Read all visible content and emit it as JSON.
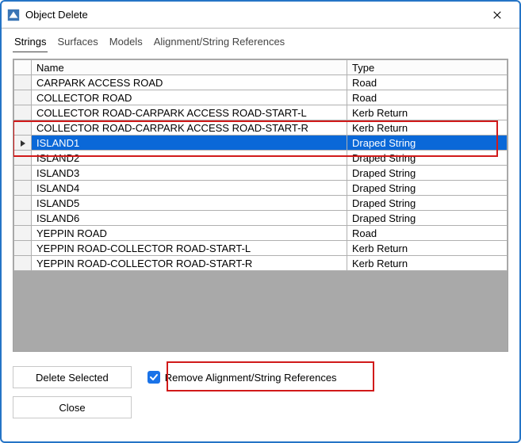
{
  "window": {
    "title": "Object Delete"
  },
  "tabs": {
    "items": [
      {
        "label": "Strings",
        "selected": true
      },
      {
        "label": "Surfaces",
        "selected": false
      },
      {
        "label": "Models",
        "selected": false
      },
      {
        "label": "Alignment/String References",
        "selected": false
      }
    ]
  },
  "grid": {
    "headers": {
      "name": "Name",
      "type": "Type"
    },
    "rows": [
      {
        "name": "CARPARK ACCESS ROAD",
        "type": "Road",
        "selected": false
      },
      {
        "name": "COLLECTOR ROAD",
        "type": "Road",
        "selected": false
      },
      {
        "name": "COLLECTOR ROAD-CARPARK ACCESS ROAD-START-L",
        "type": "Kerb Return",
        "selected": false
      },
      {
        "name": "COLLECTOR ROAD-CARPARK ACCESS ROAD-START-R",
        "type": "Kerb Return",
        "selected": false
      },
      {
        "name": "ISLAND1",
        "type": "Draped String",
        "selected": true
      },
      {
        "name": "ISLAND2",
        "type": "Draped String",
        "selected": false
      },
      {
        "name": "ISLAND3",
        "type": "Draped String",
        "selected": false
      },
      {
        "name": "ISLAND4",
        "type": "Draped String",
        "selected": false
      },
      {
        "name": "ISLAND5",
        "type": "Draped String",
        "selected": false
      },
      {
        "name": "ISLAND6",
        "type": "Draped String",
        "selected": false
      },
      {
        "name": "YEPPIN ROAD",
        "type": "Road",
        "selected": false
      },
      {
        "name": "YEPPIN ROAD-COLLECTOR ROAD-START-L",
        "type": "Kerb Return",
        "selected": false
      },
      {
        "name": "YEPPIN ROAD-COLLECTOR ROAD-START-R",
        "type": "Kerb Return",
        "selected": false
      }
    ]
  },
  "buttons": {
    "delete_selected": "Delete Selected",
    "close": "Close"
  },
  "checkbox": {
    "remove_refs_label": "Remove Alignment/String References",
    "remove_refs_checked": true
  }
}
